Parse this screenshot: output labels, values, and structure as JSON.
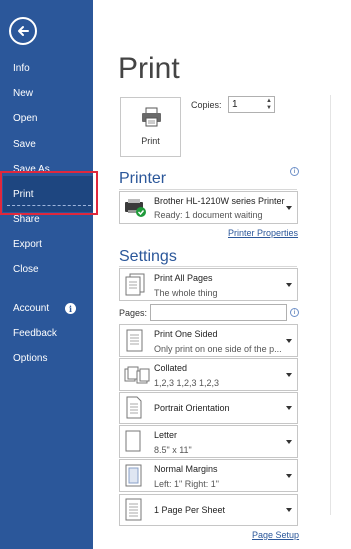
{
  "sidebar": {
    "items": [
      {
        "label": "Info"
      },
      {
        "label": "New"
      },
      {
        "label": "Open"
      },
      {
        "label": "Save"
      },
      {
        "label": "Save As"
      },
      {
        "label": "Print"
      },
      {
        "label": "Share"
      },
      {
        "label": "Export"
      },
      {
        "label": "Close"
      },
      {
        "label": "Account"
      },
      {
        "label": "Feedback"
      },
      {
        "label": "Options"
      }
    ],
    "selected": "Print",
    "bg_color": "#2b579a",
    "highlight_border_color": "#e0283c"
  },
  "main": {
    "title": "Print",
    "print_button_label": "Print",
    "copies_label": "Copies:",
    "copies_value": "1",
    "printer_heading": "Printer",
    "printer_name": "Brother HL-1210W series Printer",
    "printer_status": "Ready: 1 document waiting",
    "printer_properties_link": "Printer Properties",
    "settings_heading": "Settings",
    "pages_label": "Pages:",
    "pages_value": "",
    "page_setup_link": "Page Setup",
    "settings": [
      {
        "line1": "Print All Pages",
        "line2": "The whole thing",
        "icon": "pages-icon"
      },
      {
        "line1": "Print One Sided",
        "line2": "Only print on one side of the p...",
        "icon": "one-sided-icon"
      },
      {
        "line1": "Collated",
        "line2": "1,2,3    1,2,3    1,2,3",
        "icon": "collated-icon"
      },
      {
        "line1": "Portrait Orientation",
        "line2": "",
        "icon": "portrait-icon"
      },
      {
        "line1": "Letter",
        "line2": "8.5\" x 11\"",
        "icon": "letter-icon"
      },
      {
        "line1": "Normal Margins",
        "line2": "Left:  1\"    Right:  1\"",
        "icon": "margins-icon"
      },
      {
        "line1": "1 Page Per Sheet",
        "line2": "",
        "icon": "pages-per-sheet-icon"
      }
    ]
  }
}
